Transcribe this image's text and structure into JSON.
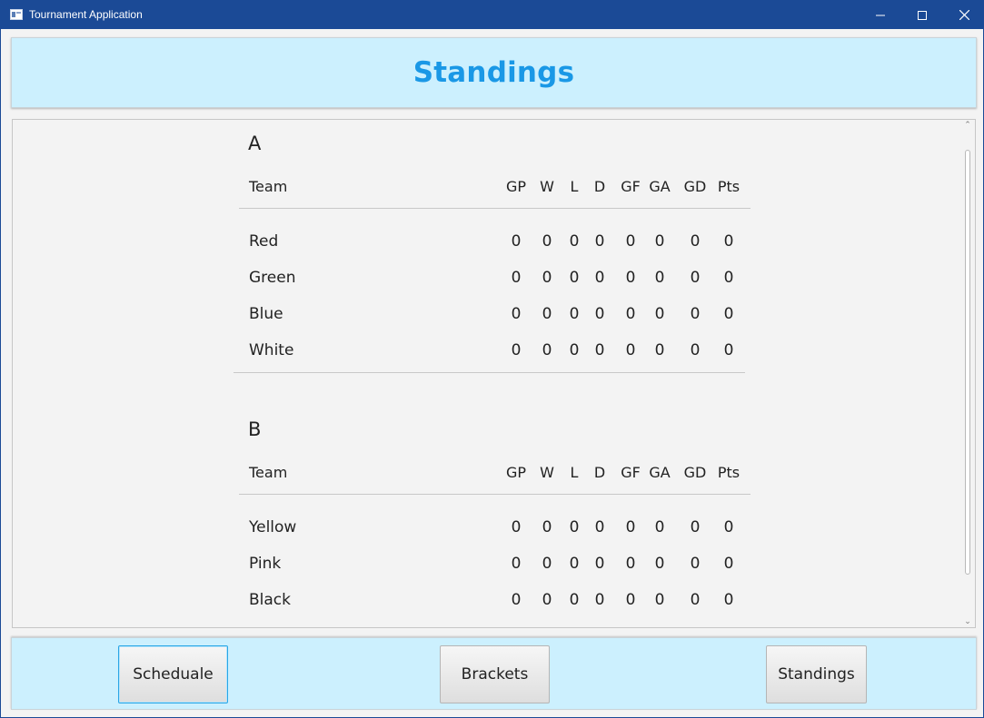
{
  "window": {
    "title": "Tournament Application"
  },
  "header": {
    "title": "Standings"
  },
  "columns": {
    "team": "Team",
    "stats": [
      "GP",
      "W",
      "L",
      "D",
      "GF",
      "GA",
      "GD",
      "Pts"
    ]
  },
  "groups": [
    {
      "name": "A",
      "rows": [
        {
          "team": "Red",
          "stats": [
            "0",
            "0",
            "0",
            "0",
            "0",
            "0",
            "0",
            "0"
          ]
        },
        {
          "team": "Green",
          "stats": [
            "0",
            "0",
            "0",
            "0",
            "0",
            "0",
            "0",
            "0"
          ]
        },
        {
          "team": "Blue",
          "stats": [
            "0",
            "0",
            "0",
            "0",
            "0",
            "0",
            "0",
            "0"
          ]
        },
        {
          "team": "White",
          "stats": [
            "0",
            "0",
            "0",
            "0",
            "0",
            "0",
            "0",
            "0"
          ]
        }
      ]
    },
    {
      "name": "B",
      "rows": [
        {
          "team": "Yellow",
          "stats": [
            "0",
            "0",
            "0",
            "0",
            "0",
            "0",
            "0",
            "0"
          ]
        },
        {
          "team": "Pink",
          "stats": [
            "0",
            "0",
            "0",
            "0",
            "0",
            "0",
            "0",
            "0"
          ]
        },
        {
          "team": "Black",
          "stats": [
            "0",
            "0",
            "0",
            "0",
            "0",
            "0",
            "0",
            "0"
          ]
        }
      ]
    }
  ],
  "nav": {
    "schedule_label": "Scheduale",
    "brackets_label": "Brackets",
    "standings_label": "Standings"
  },
  "colors": {
    "titlebar": "#1b4a96",
    "panel": "#ccf0fe",
    "title_text": "#1a98e6",
    "focus_border": "#2aa6e6"
  }
}
